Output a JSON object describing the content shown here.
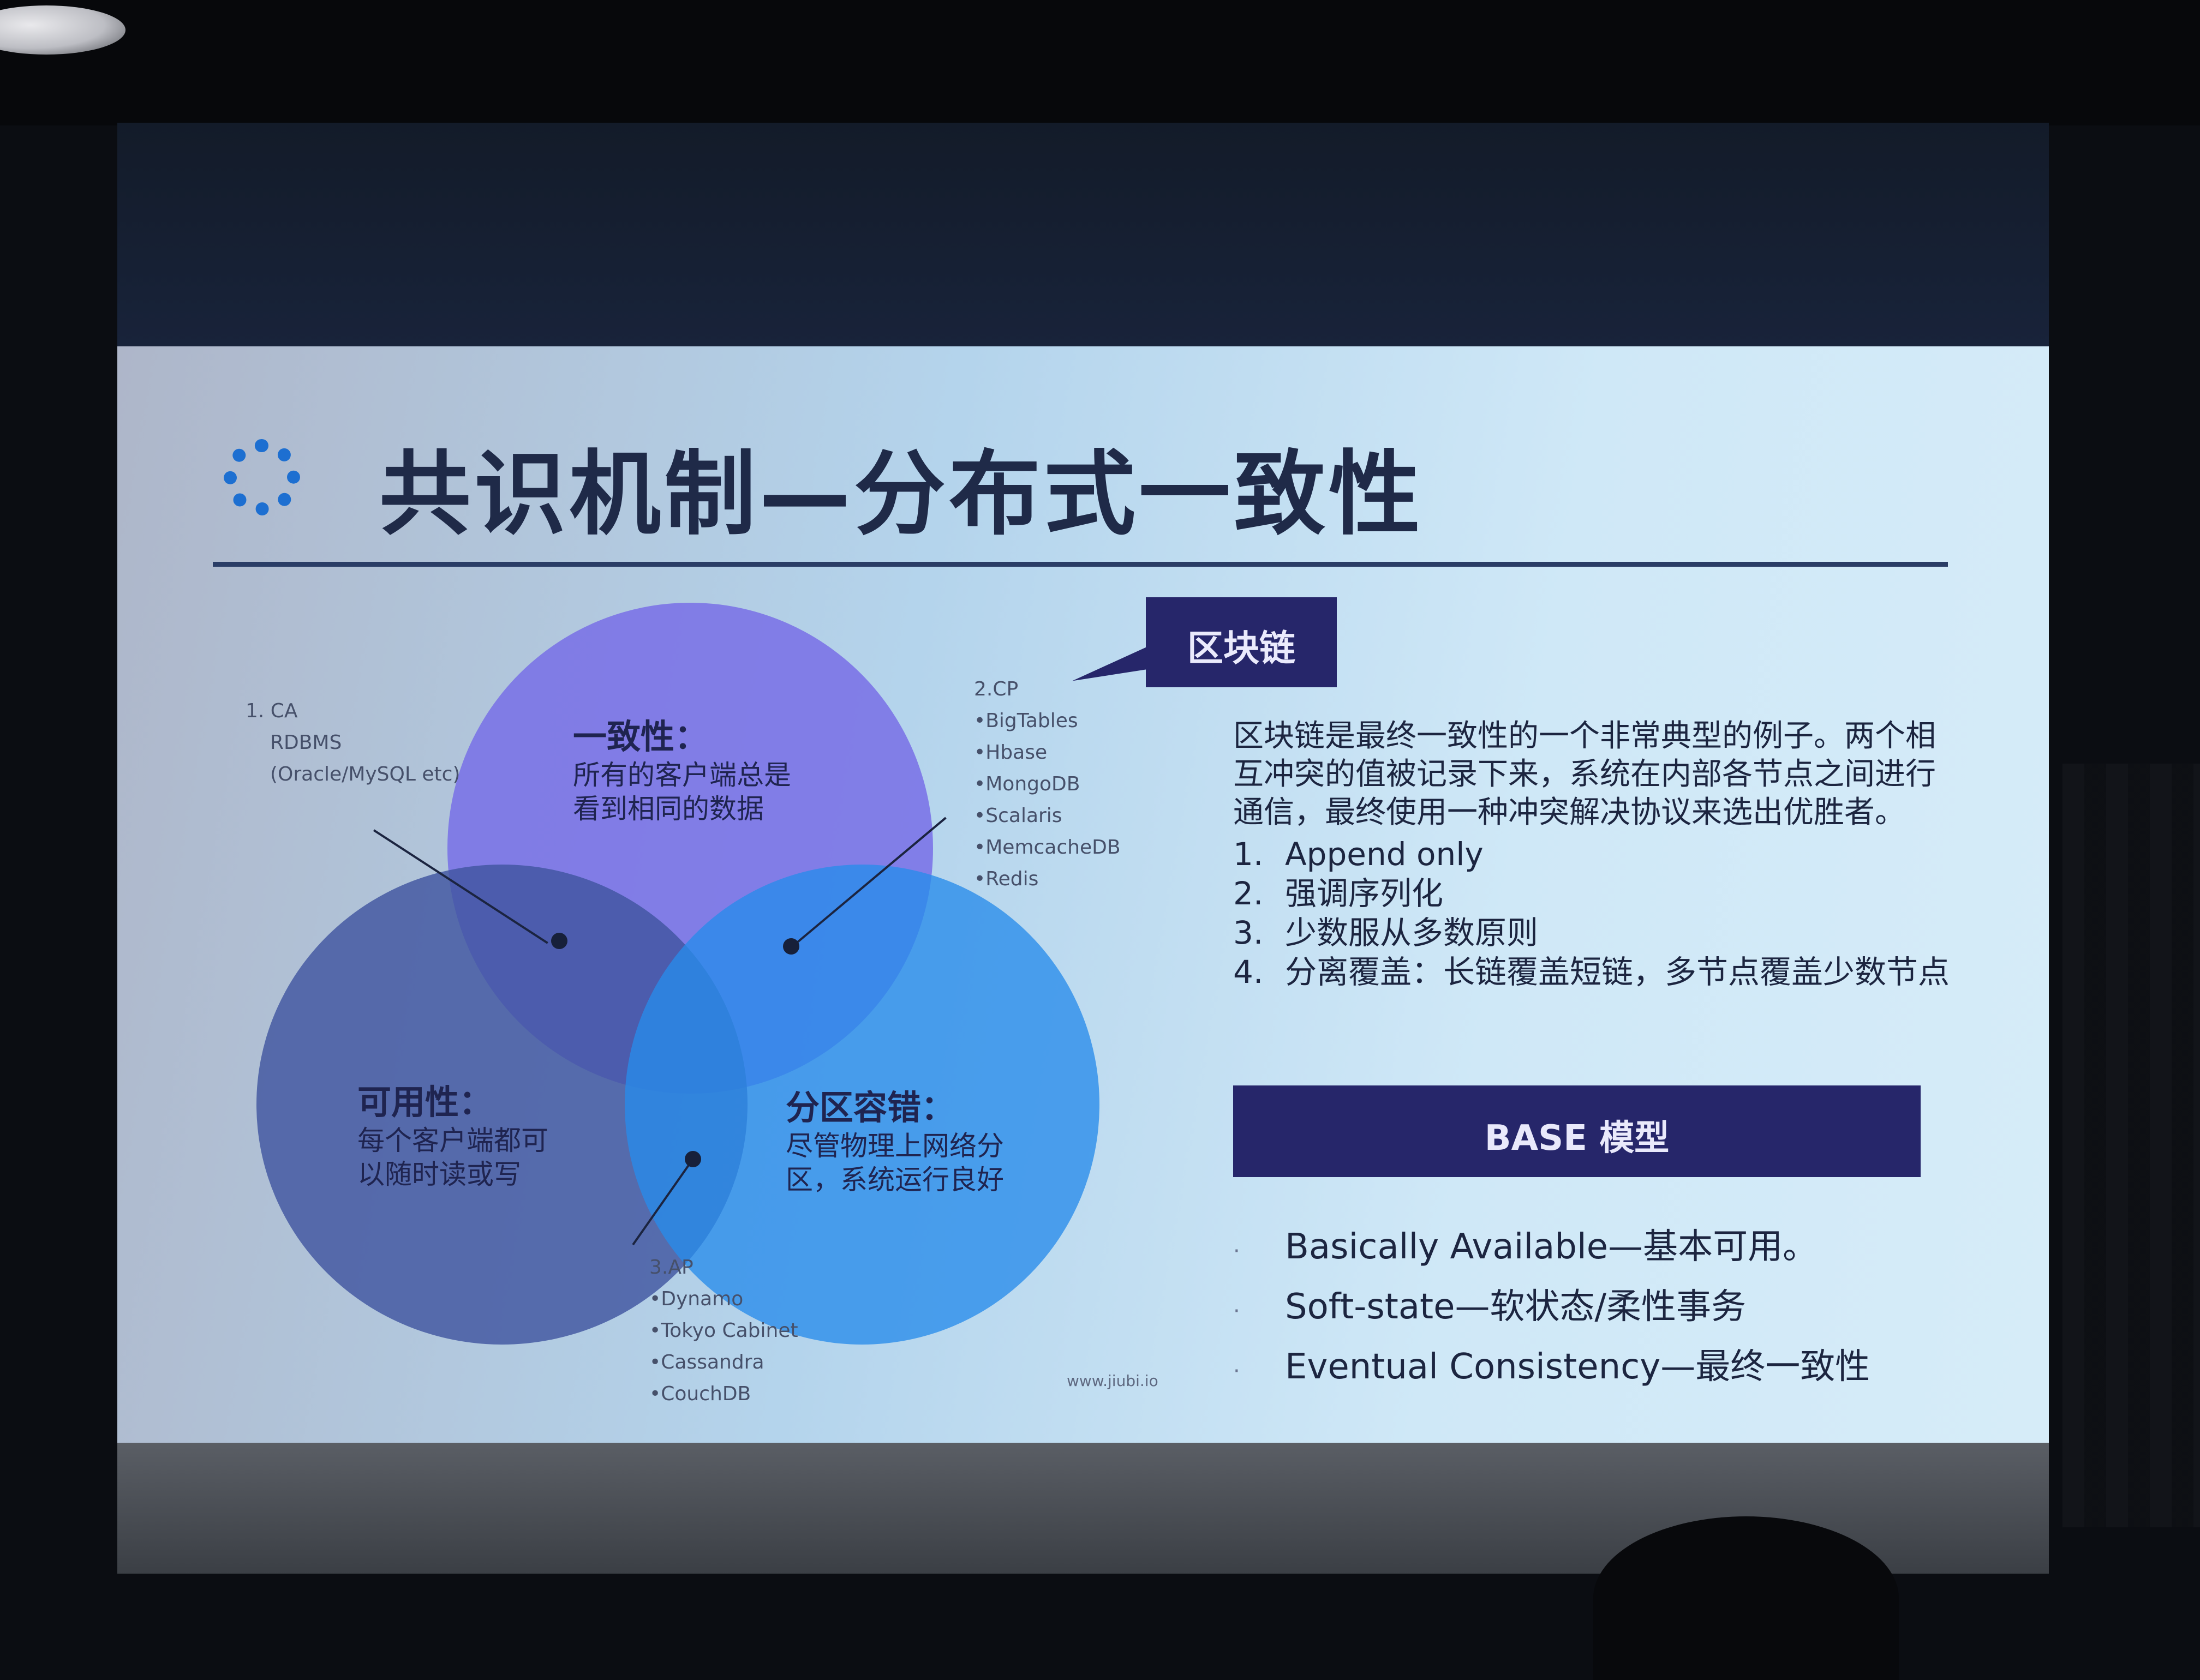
{
  "slide": {
    "title": "共识机制—分布式一致性",
    "ca": {
      "heading": "1. CA",
      "items": [
        "RDBMS",
        "(Oracle/MySQL etc)"
      ]
    },
    "cp": {
      "heading": "2.CP",
      "items": [
        "•BigTables",
        "•Hbase",
        "•MongoDB",
        "•Scalaris",
        "•MemcacheDB",
        "•Redis"
      ]
    },
    "ap": {
      "heading": "3.AP",
      "items": [
        "•Dynamo",
        "•Tokyo Cabinet",
        "•Cassandra",
        "•CouchDB"
      ]
    },
    "circles": {
      "consistency": {
        "heading": "一致性：",
        "lines": [
          "所有的客户端总是",
          "看到相同的数据"
        ]
      },
      "availability": {
        "heading": "可用性：",
        "lines": [
          "每个客户端都可",
          "以随时读或写"
        ]
      },
      "partition": {
        "heading": "分区容错：",
        "lines": [
          "尽管物理上网络分",
          "区，系统运行良好"
        ]
      }
    },
    "callout": "区块链",
    "paragraph": "区块链是最终一致性的一个非常典型的例子。两个相互冲突的值被记录下来，系统在内部各节点之间进行通信，最终使用一种冲突解决协议来选出优胜者。",
    "numbered": [
      {
        "num": "1.",
        "text": "Append only"
      },
      {
        "num": "2.",
        "text": "强调序列化"
      },
      {
        "num": "3.",
        "text": "少数服从多数原则"
      },
      {
        "num": "4.",
        "text": "分离覆盖：长链覆盖短链，多节点覆盖少数节点"
      }
    ],
    "base_title": "BASE 模型",
    "base_items": [
      {
        "bullet": "·",
        "text": "Basically Available—基本可用。"
      },
      {
        "bullet": "·",
        "text": "Soft-state—软状态/柔性事务"
      },
      {
        "bullet": "·",
        "text": "Eventual Consistency—最终一致性"
      }
    ],
    "footer": "www.jiubi.io"
  },
  "colors": {
    "title": "#1f2a48",
    "accent_box": "#26266a",
    "consistency_circle": "#786ee6",
    "availability_circle": "#4155a0",
    "partition_circle": "#288ceb"
  }
}
